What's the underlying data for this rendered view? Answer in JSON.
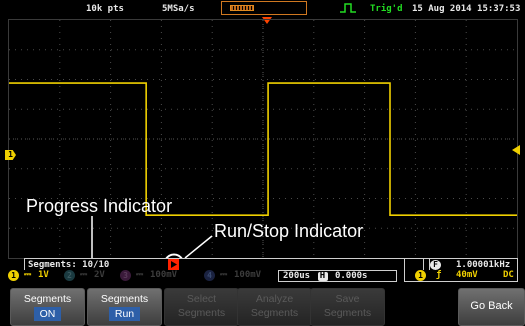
{
  "top_bar": {
    "record_length": "10k pts",
    "sample_rate": "5MSa/s",
    "trigger_status": "Trig'd",
    "datetime": "15 Aug 2014 15:37:53"
  },
  "annotations": {
    "progress": "Progress Indicator",
    "run_stop": "Run/Stop Indicator"
  },
  "status": {
    "segments": "Segments: 10/10",
    "frequency": "1.00001kHz",
    "freq_badge": "F"
  },
  "channels": [
    {
      "id": "1",
      "coupling": "⎓",
      "scale": "1V",
      "color": "#f0d000",
      "active": true
    },
    {
      "id": "2",
      "coupling": "⎓",
      "scale": "2V",
      "color": "#30d0f0",
      "active": false
    },
    {
      "id": "3",
      "coupling": "⎓",
      "scale": "100mV",
      "color": "#ff40ff",
      "active": false
    },
    {
      "id": "4",
      "coupling": "⎓",
      "scale": "100mV",
      "color": "#2060ff",
      "active": false
    }
  ],
  "horizontal": {
    "timebase": "200us",
    "h_badge": "H",
    "delay": "0.000s"
  },
  "trigger": {
    "channel": "1",
    "slope": "ƒ",
    "level": "40mV",
    "coupling": "DC"
  },
  "softmenu": [
    {
      "line1": "Segments",
      "line2": "ON",
      "enabled": true,
      "highlight": true
    },
    {
      "line1": "Segments",
      "line2": "Run",
      "enabled": true,
      "highlight": true
    },
    {
      "line1": "Select",
      "line2": "Segments",
      "enabled": false,
      "highlight": false
    },
    {
      "line1": "Analyze",
      "line2": "Segments",
      "enabled": false,
      "highlight": false
    },
    {
      "line1": "Save",
      "line2": "Segments",
      "enabled": false,
      "highlight": false
    }
  ],
  "go_back": "Go Back",
  "waveform": {
    "high_level_fraction": 0.265,
    "low_level_fraction": 0.82,
    "transitions_fraction": [
      0.27,
      0.51,
      0.75
    ],
    "start_level": "high"
  },
  "colors": {
    "ch1": "#f0d000",
    "trigger_marker": "#ff4400",
    "run_stop": "#ff2200"
  }
}
